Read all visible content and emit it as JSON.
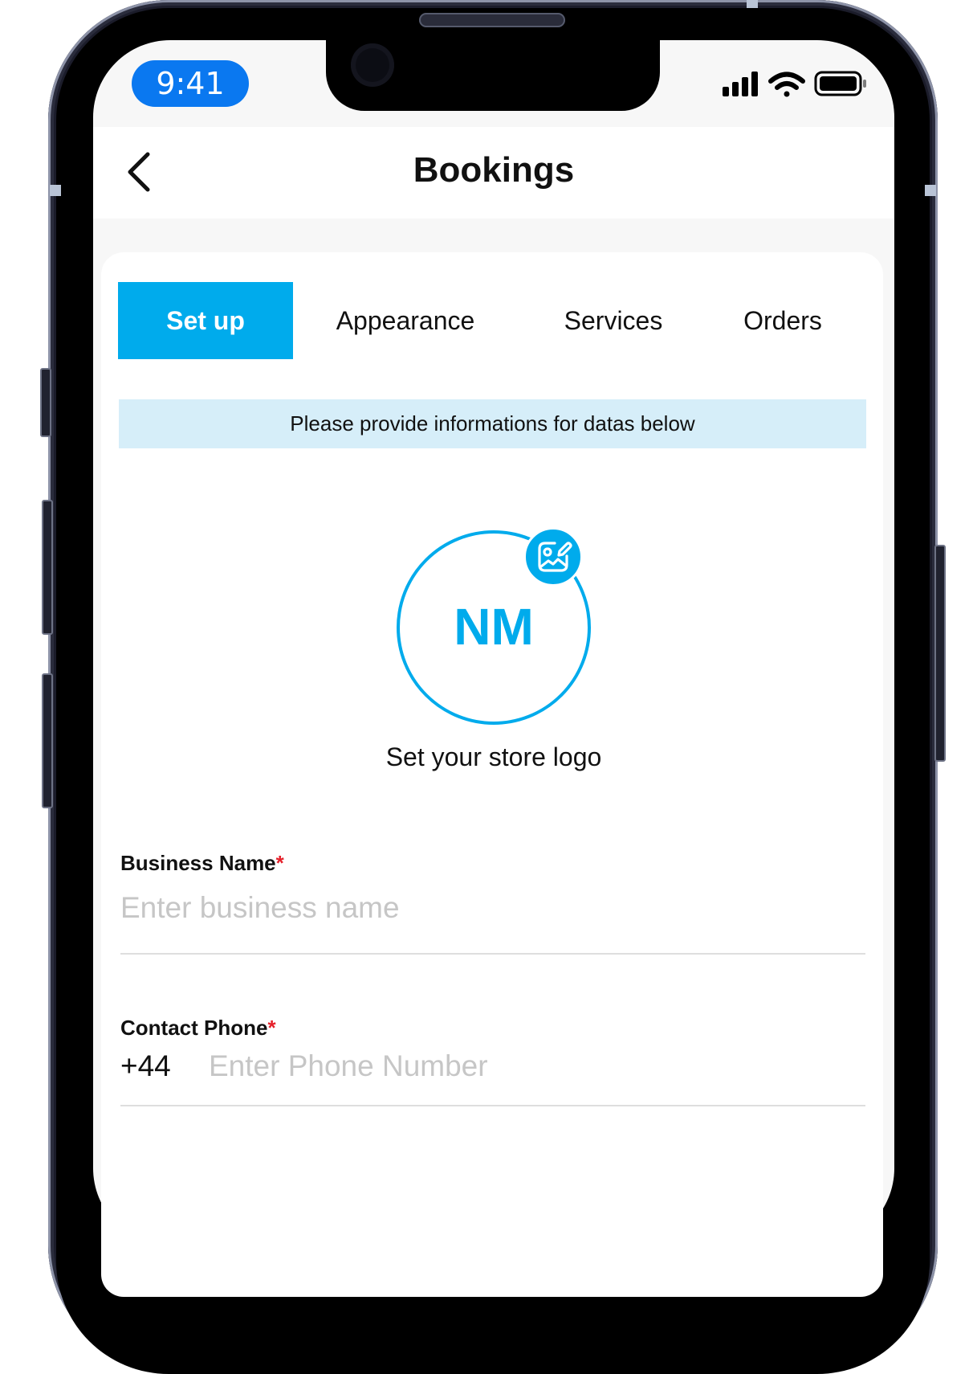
{
  "status_bar": {
    "time": "9:41"
  },
  "header": {
    "title": "Bookings",
    "back_icon": "chevron-left-icon"
  },
  "tabs": [
    {
      "label": "Set up",
      "active": true
    },
    {
      "label": "Appearance",
      "active": false
    },
    {
      "label": "Services",
      "active": false
    },
    {
      "label": "Orders",
      "active": false
    }
  ],
  "info_banner": "Please provide informations for datas below",
  "logo": {
    "initials": "NM",
    "caption": "Set your store logo",
    "edit_icon": "image-edit-icon"
  },
  "form": {
    "business_name": {
      "label": "Business Name",
      "required_mark": "*",
      "value": "",
      "placeholder": "Enter business name"
    },
    "contact_phone": {
      "label": "Contact Phone",
      "required_mark": "*",
      "dial_code": "+44",
      "value": "",
      "placeholder": "Enter Phone Number"
    }
  },
  "colors": {
    "accent": "#00abec",
    "banner_bg": "#d6eef9",
    "time_pill": "#0a78f0",
    "required": "#e5202a"
  }
}
